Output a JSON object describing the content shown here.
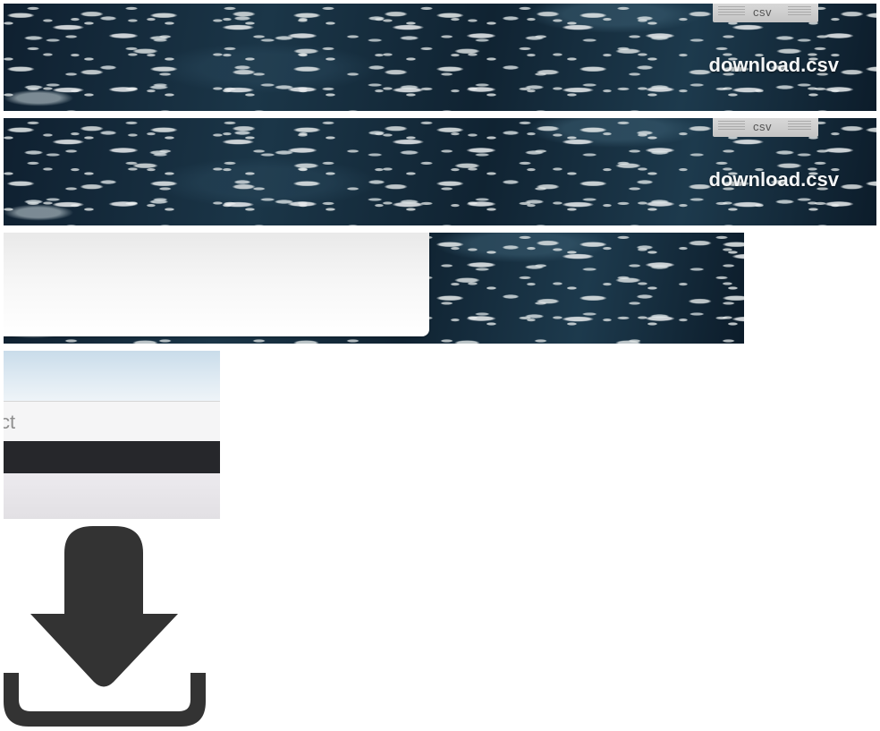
{
  "banners": [
    {
      "tab_label": "csv",
      "filename": "download.csv"
    },
    {
      "tab_label": "csv",
      "filename": "download.csv"
    }
  ],
  "fragment": {
    "partial_text": "ct"
  },
  "icons": {
    "file_tab": "csv-file-tab-icon",
    "download": "download-icon"
  },
  "colors": {
    "water_dark": "#152b3a",
    "filename_text": "#f4f6f7",
    "icon_fill": "#333333",
    "dark_bar": "#26272b"
  }
}
